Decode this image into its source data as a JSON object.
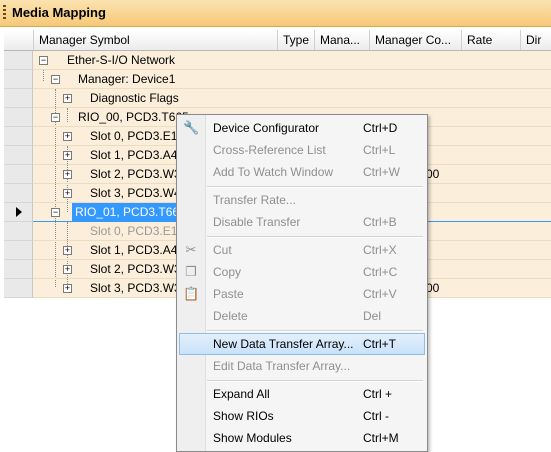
{
  "title": "Media Mapping",
  "columns": [
    "Manager Symbol",
    "Type",
    "Mana...",
    "Manager Co...",
    "Rate",
    "Dir"
  ],
  "rows": [
    {
      "label": "Ether-S-I/O Network"
    },
    {
      "label": "Manager: Device1"
    },
    {
      "label": "Diagnostic Flags"
    },
    {
      "label": "RIO_00, PCD3.T665"
    },
    {
      "label": "Slot 0, PCD3.E11("
    },
    {
      "label": "Slot 1, PCD3.A40("
    },
    {
      "label": "Slot 2, PCD3.W34",
      "extra": "00"
    },
    {
      "label": "Slot 3, PCD3.W40"
    },
    {
      "label": "RIO_01, PCD3.T66("
    },
    {
      "label": "Slot 0, PCD3.E11("
    },
    {
      "label": "Slot 1, PCD3.A40("
    },
    {
      "label": "Slot 2, PCD3.W30"
    },
    {
      "label": "Slot 3, PCD3.W34",
      "extra": "00"
    }
  ],
  "menu": [
    {
      "label": "Device Configurator",
      "shortcut": "Ctrl+D",
      "icon": "wrench-icon",
      "glyph": "🔧",
      "disabled": false
    },
    {
      "label": "Cross-Reference List",
      "shortcut": "Ctrl+L",
      "disabled": true
    },
    {
      "label": "Add To Watch Window",
      "shortcut": "Ctrl+W",
      "disabled": true
    },
    {
      "label": "Transfer Rate...",
      "shortcut": "",
      "disabled": true
    },
    {
      "label": "Disable Transfer",
      "shortcut": "Ctrl+B",
      "disabled": true
    },
    {
      "label": "Cut",
      "shortcut": "Ctrl+X",
      "icon": "scissors-icon",
      "glyph": "✂",
      "disabled": true
    },
    {
      "label": "Copy",
      "shortcut": "Ctrl+C",
      "icon": "copy-icon",
      "glyph": "❐",
      "disabled": true
    },
    {
      "label": "Paste",
      "shortcut": "Ctrl+V",
      "icon": "paste-icon",
      "glyph": "📋",
      "disabled": true
    },
    {
      "label": "Delete",
      "shortcut": "Del",
      "disabled": true
    },
    {
      "label": "New Data Transfer Array...",
      "shortcut": "Ctrl+T",
      "disabled": false,
      "highlighted": true
    },
    {
      "label": "Edit Data Transfer Array...",
      "shortcut": "",
      "disabled": true
    },
    {
      "label": "Expand All",
      "shortcut": "Ctrl +",
      "disabled": false
    },
    {
      "label": "Show RIOs",
      "shortcut": "Ctrl -",
      "disabled": false
    },
    {
      "label": "Show Modules",
      "shortcut": "Ctrl+M",
      "disabled": false
    }
  ]
}
